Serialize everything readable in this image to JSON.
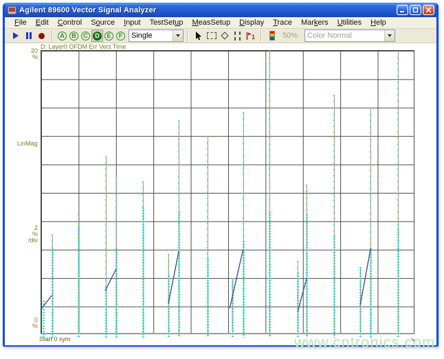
{
  "window": {
    "title": "Agilent 89600 Vector Signal Analyzer"
  },
  "menu": {
    "items": [
      {
        "label": "File",
        "u": 0
      },
      {
        "label": "Edit",
        "u": 0
      },
      {
        "label": "Control",
        "u": 0
      },
      {
        "label": "Source",
        "u": 1
      },
      {
        "label": "Input",
        "u": 0
      },
      {
        "label": "TestSetup",
        "u": 7
      },
      {
        "label": "MeasSetup",
        "u": 0
      },
      {
        "label": "Display",
        "u": 0
      },
      {
        "label": "Trace",
        "u": 0
      },
      {
        "label": "Markers",
        "u": 3
      },
      {
        "label": "Utilities",
        "u": 0
      },
      {
        "label": "Help",
        "u": 0
      }
    ]
  },
  "toolbar": {
    "trace_buttons": [
      "A",
      "B",
      "C",
      "D",
      "E",
      "F"
    ],
    "active_trace": "D",
    "mode_select": "Single",
    "zoom_level": "50%",
    "color_mode": "Color Normal"
  },
  "chart_data": {
    "type": "scatter",
    "title": "D: Layer0 OFDM Err Vect Time",
    "y_axis": {
      "top_value": "20",
      "top_unit": "%",
      "format_label": "LinMag",
      "per_div_value": "2",
      "per_div_unit": "%",
      "per_div_suffix": "/div",
      "bottom_value": "0",
      "bottom_unit": "%",
      "ylim": [
        0,
        20
      ],
      "divisions": 10
    },
    "x_axis": {
      "start_label": "Start 0 sym",
      "divisions": 10
    },
    "grid": true,
    "colors": {
      "stem_line": "#a79d4a",
      "dots": "#35dede",
      "segments": "#3d4f9b",
      "grid": "#4a4a4a",
      "labels": "#7e7a1e"
    },
    "stems": [
      {
        "x": 0.0055,
        "peak": 2.4,
        "dense_from": 2.4,
        "line": false
      },
      {
        "x": 0.0294,
        "peak": 7.1,
        "dense_from": 6.1
      },
      {
        "x": 0.0993,
        "peak": 8.5,
        "dense_from": 7.5
      },
      {
        "x": 0.1728,
        "peak": 12.6,
        "dense_from": 3.4
      },
      {
        "x": 0.2004,
        "peak": 11.2,
        "dense_from": 6.1
      },
      {
        "x": 0.2721,
        "peak": 10.8,
        "dense_from": 9.0
      },
      {
        "x": 0.3401,
        "peak": 5.7,
        "dense_from": 4.2
      },
      {
        "x": 0.3676,
        "peak": 15.1,
        "dense_from": 8.7
      },
      {
        "x": 0.4449,
        "peak": 14.0,
        "dense_from": 5.4
      },
      {
        "x": 0.511,
        "peak": 4.0,
        "dense_from": 4.0
      },
      {
        "x": 0.5404,
        "peak": 15.7,
        "dense_from": 6.6
      },
      {
        "x": 0.6103,
        "peak": 20.0,
        "dense_from": 8.7
      },
      {
        "x": 0.6857,
        "peak": 5.2,
        "dense_from": 4.4
      },
      {
        "x": 0.7096,
        "peak": 10.6,
        "dense_from": 8.5
      },
      {
        "x": 0.7831,
        "peak": 16.9,
        "dense_from": 7.0
      },
      {
        "x": 0.8529,
        "peak": 4.8,
        "dense_from": 4.8
      },
      {
        "x": 0.8805,
        "peak": 16.0,
        "dense_from": 6.1
      },
      {
        "x": 0.954,
        "peak": 20.0,
        "dense_from": 7.5
      }
    ],
    "segments": [
      {
        "x1": 0.0,
        "y1": 1.84,
        "x2": 0.029,
        "y2": 2.8
      },
      {
        "x1": 0.171,
        "y1": 3.1,
        "x2": 0.2,
        "y2": 4.64
      },
      {
        "x1": 0.34,
        "y1": 2.22,
        "x2": 0.368,
        "y2": 5.9
      },
      {
        "x1": 0.504,
        "y1": 1.88,
        "x2": 0.54,
        "y2": 6.04
      },
      {
        "x1": 0.686,
        "y1": 1.64,
        "x2": 0.71,
        "y2": 4.0
      },
      {
        "x1": 0.853,
        "y1": 2.08,
        "x2": 0.881,
        "y2": 6.1
      }
    ]
  },
  "watermark": "www.cntronics.com"
}
